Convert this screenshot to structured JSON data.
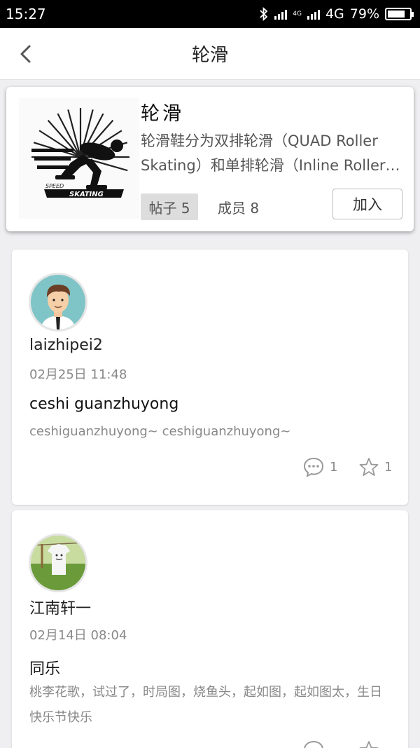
{
  "status_bar": {
    "time": "15:27",
    "network_small": "4G",
    "network": "4G",
    "battery": "79%",
    "battery_level": 0.79
  },
  "nav": {
    "title": "轮滑"
  },
  "group": {
    "logo_text_top": "SPEED",
    "logo_text_bottom": "SKATING",
    "name": "轮滑",
    "description": "轮滑鞋分为双排轮滑（QUAD Roller Skating）和单排轮滑（Inline Roller Skating）",
    "posts_label": "帖子 5",
    "members_label": "成员 8",
    "join_label": "加入"
  },
  "posts": [
    {
      "username": "laizhipei2",
      "time": "02月25日 11:48",
      "title": "ceshi guanzhuyong",
      "body": "ceshiguanzhuyong~ ceshiguanzhuyong~",
      "comments": "1",
      "stars": "1"
    },
    {
      "username": "江南轩一",
      "time": "02月14日 08:04",
      "title": "同乐",
      "body": "桃李花歌，试过了，时局图，烧鱼头，起如图，起如图太，生日快乐节快乐"
    }
  ]
}
